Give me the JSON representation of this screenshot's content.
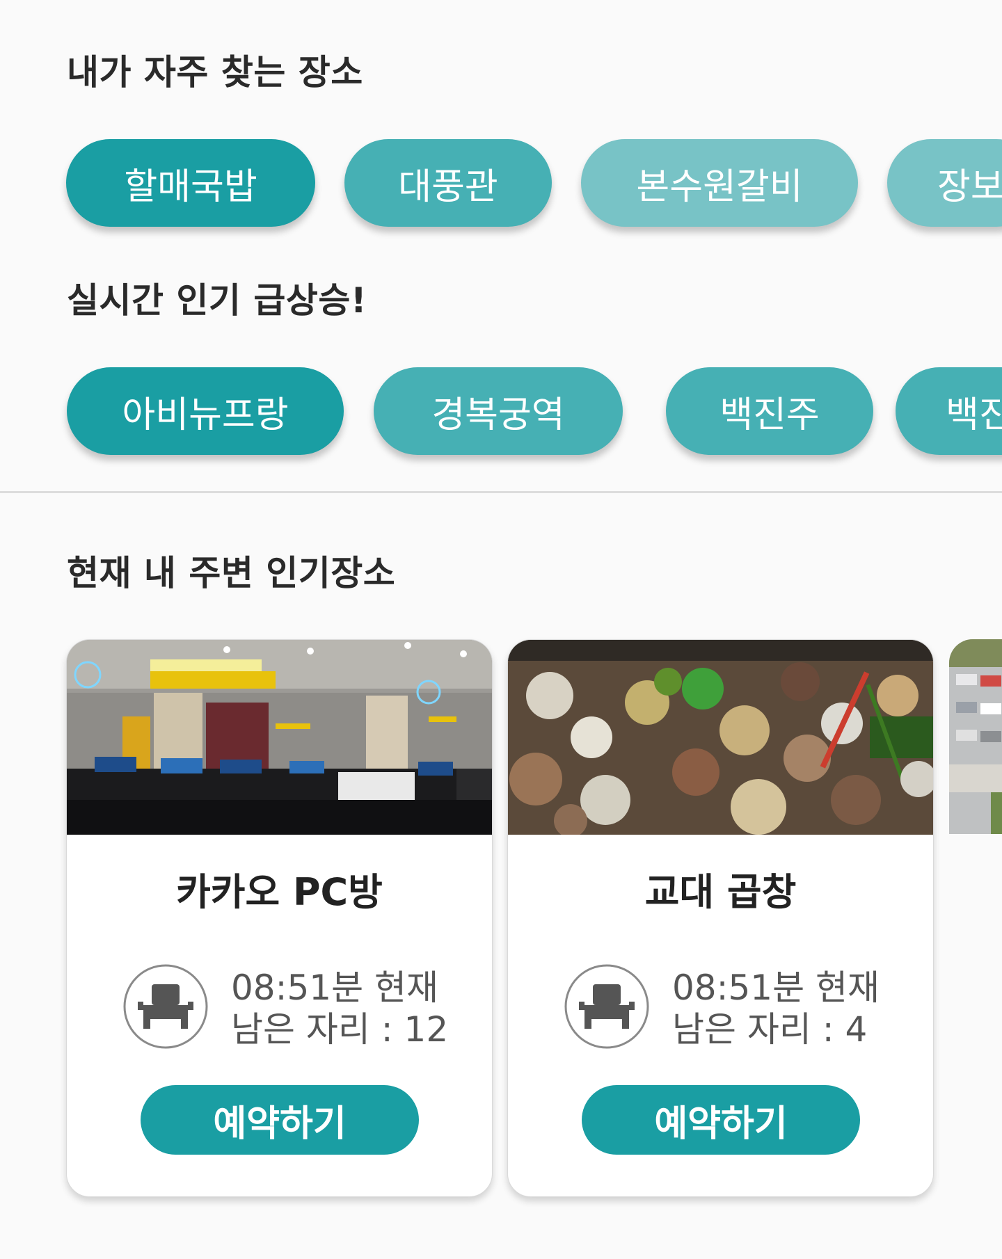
{
  "sections": {
    "frequent_title": "내가 자주 찾는 장소",
    "trending_title": "실시간 인기 급상승!",
    "nearby_title": "현재 내 주변 인기장소"
  },
  "frequent_places": [
    "할매국밥",
    "대풍관",
    "본수원갈비",
    "장보"
  ],
  "trending_places": [
    "아비뉴프랑",
    "경복궁역",
    "백진주",
    "백진"
  ],
  "nearby": [
    {
      "name": "카카오 PC방",
      "time_text": "08:51분 현재",
      "seats_text": "남은 자리 : 12",
      "button": "예약하기",
      "photo": "pc-room-photo"
    },
    {
      "name": "교대 곱창",
      "time_text": "08:51분 현재",
      "seats_text": "남은 자리 : 4",
      "button": "예약하기",
      "photo": "gopchang-photo"
    }
  ],
  "colors": {
    "primary": "#1a9ea3",
    "chip_mid": "#46b0b4",
    "chip_light": "#78c3c6",
    "background": "#fafafa"
  }
}
